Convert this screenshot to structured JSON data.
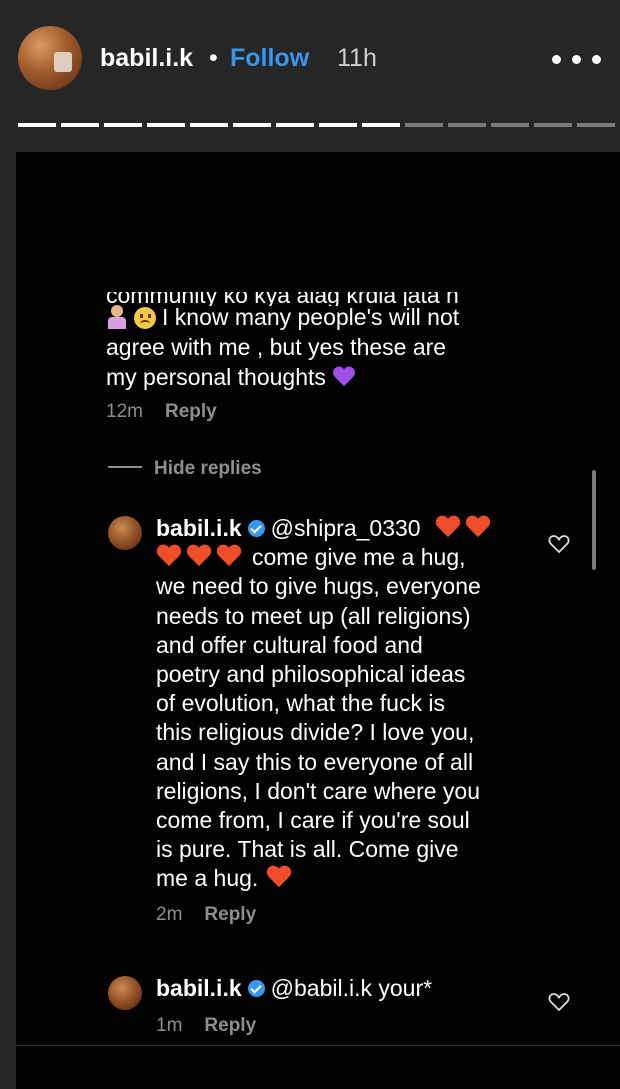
{
  "story_header": {
    "username": "babil.i.k",
    "separator": "•",
    "follow_label": "Follow",
    "time": "11h",
    "progress_segments_total": 14,
    "progress_segments_seen": 9
  },
  "colors": {
    "background": "#262626",
    "content_bg": "#020202",
    "follow": "#3897f0",
    "meta": "#8e8e8e",
    "heart_orange": "#f04e2a",
    "heart_purple": "#a14ee8"
  },
  "comment": {
    "cut_line": "community ko kya alag krdia jata h",
    "lines": [
      "I know many people's will not",
      "agree with me , but yes these are",
      "my personal thoughts"
    ],
    "time": "12m",
    "reply_label": "Reply"
  },
  "hide_replies_label": "Hide replies",
  "reply1": {
    "username": "babil.i.k",
    "mention": "@shipra_0330",
    "line2_text": "come give me a hug,",
    "lines": [
      "we need to give hugs, everyone",
      "needs to meet up (all religions)",
      "and offer cultural food and",
      "poetry and philosophical ideas",
      "of evolution, what the fuck is",
      "this religious divide? I love you,",
      "and I say this to everyone of all",
      "religions, I don't care where you",
      "come from, I care if you're soul",
      "is pure. That is all. Come give"
    ],
    "last_line": "me a hug.",
    "time": "2m",
    "reply_label": "Reply"
  },
  "reply2": {
    "username": "babil.i.k",
    "text": "@babil.i.k your*",
    "time": "1m",
    "reply_label": "Reply"
  }
}
